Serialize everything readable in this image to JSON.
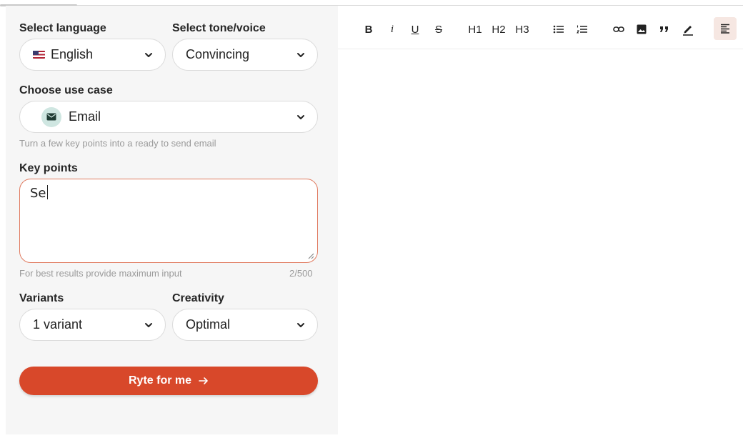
{
  "form": {
    "language": {
      "label": "Select language",
      "value": "English"
    },
    "tone": {
      "label": "Select tone/voice",
      "value": "Convincing"
    },
    "use_case": {
      "label": "Choose use case",
      "value": "Email",
      "hint": "Turn a few key points into a ready to send email"
    },
    "key_points": {
      "label": "Key points",
      "value": "Se",
      "hint": "For best results provide maximum input",
      "counter": "2/500"
    },
    "variants": {
      "label": "Variants",
      "value": "1 variant"
    },
    "creativity": {
      "label": "Creativity",
      "value": "Optimal"
    },
    "submit_label": "Ryte for me"
  },
  "toolbar": {
    "bold": "B",
    "italic": "i",
    "underline": "U",
    "strike": "S",
    "h1": "H1",
    "h2": "H2",
    "h3": "H3"
  },
  "icons": {
    "chevron": "chevron-down-icon",
    "flag": "us-flag-icon",
    "email": "envelope-icon",
    "arrow": "arrow-right-icon"
  },
  "colors": {
    "accent": "#d8482a",
    "textarea_border": "#e07a5f",
    "active_tool_bg": "#f6e7e2",
    "email_badge": "#cfe6e1"
  }
}
